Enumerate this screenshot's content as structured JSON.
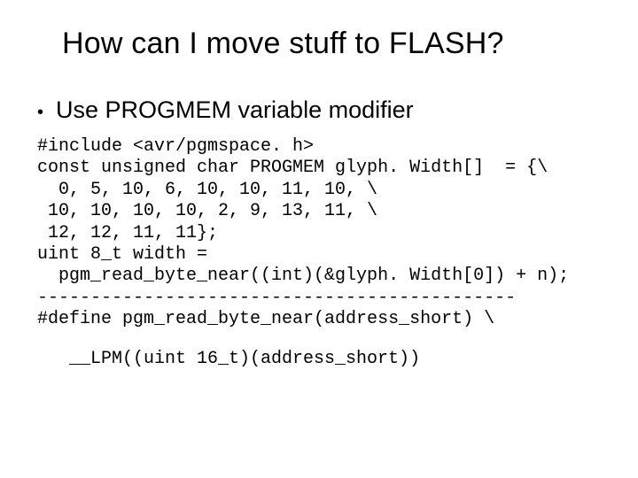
{
  "title": "How can I move stuff to FLASH?",
  "bullet": {
    "dot": "•",
    "text": "Use PROGMEM variable modifier"
  },
  "code": {
    "l1": "#include <avr/pgmspace. h>",
    "l2": "const unsigned char PROGMEM glyph. Width[]  = {\\",
    "l3": "  0, 5, 10, 6, 10, 10, 11, 10, \\",
    "l4": " 10, 10, 10, 10, 2, 9, 13, 11, \\",
    "l5": " 12, 12, 11, 11};",
    "l6": "uint 8_t width =",
    "l7": "  pgm_read_byte_near((int)(&glyph. Width[0]) + n);",
    "divider": "---------------------------------------------",
    "l8": "#define pgm_read_byte_near(address_short) \\",
    "l9": "__LPM((uint 16_t)(address_short))"
  }
}
